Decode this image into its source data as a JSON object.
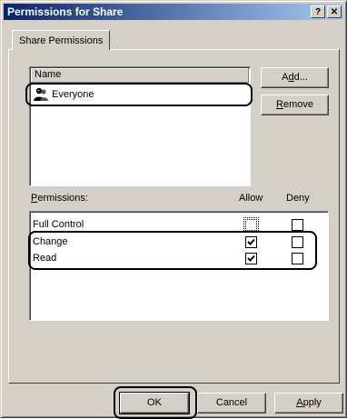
{
  "window": {
    "title": "Permissions for Share",
    "help_label": "?",
    "close_label": "✕"
  },
  "tabs": [
    {
      "label": "Share Permissions"
    }
  ],
  "name_list": {
    "header": "Name",
    "items": [
      {
        "label": "Everyone",
        "icon": "users-group-icon"
      }
    ]
  },
  "buttons": {
    "add": {
      "before": "A",
      "mnemonic": "d",
      "after": "d..."
    },
    "remove": {
      "before": "",
      "mnemonic": "R",
      "after": "emove"
    },
    "ok": "OK",
    "cancel": "Cancel",
    "apply": {
      "before": "",
      "mnemonic": "A",
      "after": "pply"
    }
  },
  "permissions": {
    "label_mnemonic": "P",
    "label_rest": "ermissions:",
    "allow_header": "Allow",
    "deny_header": "Deny",
    "rows": [
      {
        "name": "Full Control",
        "allow": false,
        "deny": false
      },
      {
        "name": "Change",
        "allow": true,
        "deny": false
      },
      {
        "name": "Read",
        "allow": true,
        "deny": false
      }
    ]
  },
  "colors": {
    "title_start": "#0a246a",
    "title_end": "#a6caf0",
    "face": "#d4d0c8"
  }
}
